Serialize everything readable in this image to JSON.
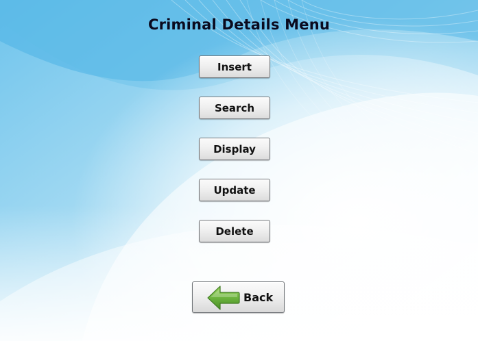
{
  "window": {
    "title": "Criminal Details Menu"
  },
  "menu": {
    "buttons": [
      {
        "label": "Insert"
      },
      {
        "label": "Search"
      },
      {
        "label": "Display"
      },
      {
        "label": "Update"
      },
      {
        "label": "Delete"
      }
    ]
  },
  "back": {
    "label": "Back",
    "icon": "arrow-left-icon",
    "icon_color": "#6cb33e"
  },
  "colors": {
    "background_primary": "#7fcbee",
    "background_secondary": "#ffffff",
    "title_text": "#0a0a1e"
  }
}
